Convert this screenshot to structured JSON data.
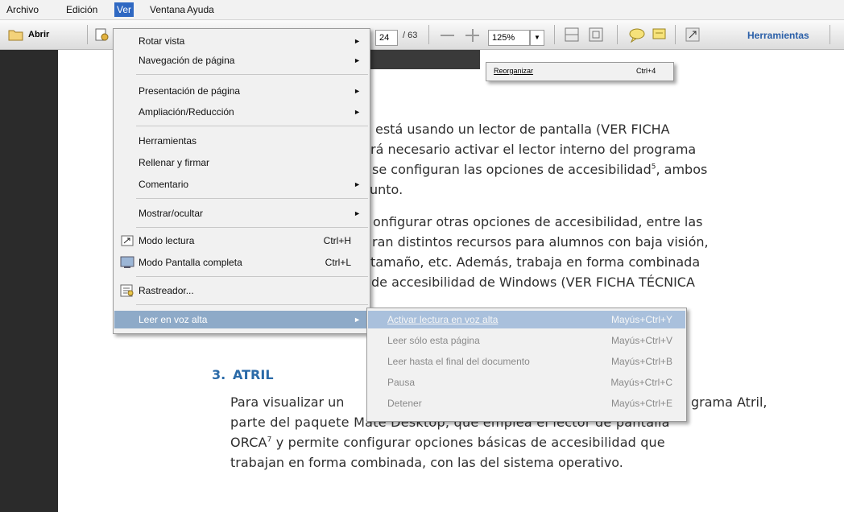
{
  "menubar": {
    "items": [
      "Archivo",
      "Edición",
      "Ver",
      "Ventana",
      "Ayuda"
    ]
  },
  "toolbar": {
    "open_label": "Abrir",
    "page_current": "24",
    "page_total": "/ 63",
    "zoom": "125%",
    "tools_label": "Herramientas"
  },
  "reorganize_menu": {
    "label": "Reorganizar",
    "shortcut": "Ctrl+4"
  },
  "ver_menu": {
    "items": [
      {
        "label": "Rotar vista"
      },
      {
        "label": "Navegación de página"
      },
      {
        "label": "Presentación de página"
      },
      {
        "label": "Ampliación/Reducción"
      },
      {
        "label": "Herramientas"
      },
      {
        "label": "Rellenar y firmar"
      },
      {
        "label": "Comentario"
      },
      {
        "label": "Mostrar/ocultar"
      },
      {
        "label": "Modo lectura",
        "shortcut": "Ctrl+H"
      },
      {
        "label": "Modo Pantalla completa",
        "shortcut": "Ctrl+L"
      },
      {
        "label": "Rastreador..."
      },
      {
        "label": "Leer en voz alta"
      }
    ]
  },
  "read_aloud_menu": {
    "items": [
      {
        "label": "Activar lectura en voz alta",
        "shortcut": "Mayús+Ctrl+Y"
      },
      {
        "label": "Leer sólo esta página",
        "shortcut": "Mayús+Ctrl+V"
      },
      {
        "label": "Leer hasta el final del documento",
        "shortcut": "Mayús+Ctrl+B"
      },
      {
        "label": "Pausa",
        "shortcut": "Mayús+Ctrl+C"
      },
      {
        "label": "Detener",
        "shortcut": "Mayús+Ctrl+E"
      }
    ]
  },
  "document": {
    "para1": [
      "está usando un lector de pantalla (VER FICHA",
      "rá necesario activar el lector interno del programa",
      "se configuran las opciones de accesibilidad",
      "unto."
    ],
    "para1_footnote": "5",
    "para1_tail": ", ambos",
    "para2": [
      "onfigurar otras opciones de accesibilidad, entre las",
      "ran distintos recursos para alumnos con baja visión,",
      "tamaño, etc. Además, trabaja en forma combinada",
      "de accesibilidad de Windows (VER FICHA TÉCNICA"
    ],
    "heading_number": "3.",
    "heading_text": "ATRIL",
    "para3": [
      "Para visualizar un",
      "grama Atril,",
      "parte del paquete Mate Desktop, que emplea el lector de pantalla",
      "ORCA",
      " y permite configurar opciones básicas de accesibilidad que",
      "trabajan en forma combinada, con las del sistema operativo."
    ],
    "para3_footnote": "7"
  },
  "colors": {
    "accent": "#2f68c2",
    "heading": "#2a6aa8",
    "highlight": "#8eaac8"
  }
}
